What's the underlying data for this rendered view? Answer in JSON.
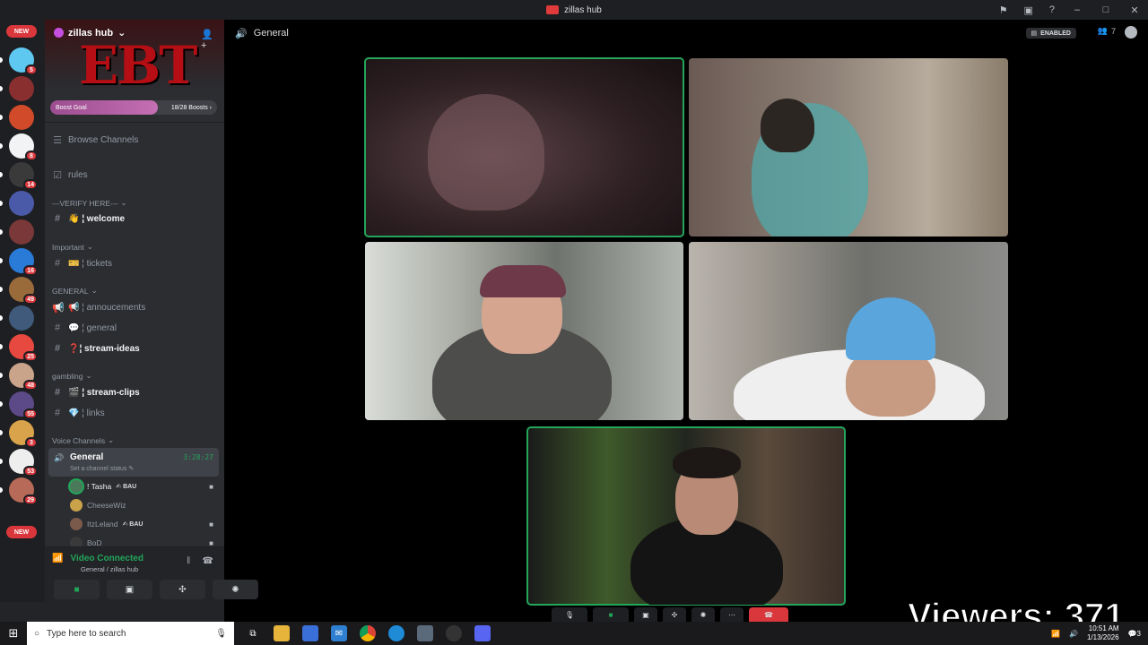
{
  "window": {
    "title": "zillas hub"
  },
  "rail": {
    "new_top": "NEW",
    "new_bottom": "NEW",
    "servers": [
      {
        "badge": "5"
      },
      {
        "badge": ""
      },
      {
        "badge": ""
      },
      {
        "badge": "8"
      },
      {
        "badge": "14"
      },
      {
        "badge": ""
      },
      {
        "badge": ""
      },
      {
        "badge": "16"
      },
      {
        "badge": "49"
      },
      {
        "badge": ""
      },
      {
        "badge": "25"
      },
      {
        "badge": "48"
      },
      {
        "badge": "55"
      },
      {
        "badge": "3"
      },
      {
        "badge": "53"
      },
      {
        "badge": "29"
      }
    ]
  },
  "sidebar": {
    "server_name": "zillas hub",
    "banner_text": "EBT",
    "boost_goal": {
      "label": "Boost Goal",
      "count": "18/28 Boosts",
      "progress": 0.643
    },
    "browse_channels": "Browse Channels",
    "rules": "rules",
    "categories": {
      "verify": "---VERIFY HERE---",
      "important": "Important",
      "general": "GENERAL",
      "gambling": "gambling",
      "voice": "Voice Channels"
    },
    "channels": {
      "welcome": "👋 ¦ welcome",
      "tickets": "🎫 ¦ tickets",
      "annoucements": "📢 ¦ annoucements",
      "general": "💬 ¦ general",
      "stream_ideas": "❓¦ stream-ideas",
      "stream_clips": "🎬 ¦ stream-clips",
      "links": "💎 ¦ links"
    },
    "voice_channel": {
      "name": "General",
      "status": "Set a channel status",
      "time": "3:28:27",
      "users": [
        {
          "name": "! Tasha",
          "tag": "BAU",
          "speaking": true,
          "camera": true
        },
        {
          "name": "CheeseWiz",
          "tag": "",
          "speaking": false,
          "camera": false
        },
        {
          "name": "ItzLeland",
          "tag": "BAU",
          "speaking": false,
          "camera": true
        },
        {
          "name": "BoD",
          "tag": "",
          "speaking": false,
          "camera": true
        }
      ]
    },
    "voice_panel": {
      "status": "Video Connected",
      "location": "General / zillas hub"
    }
  },
  "stage": {
    "channel": "General",
    "enabled_label": "ENABLED",
    "member_count": "7"
  },
  "overlay": {
    "viewers": "Viewers: 371"
  },
  "taskbar": {
    "search_placeholder": "Type here to search",
    "time": "10:51 AM",
    "date": "1/13/2026",
    "notifications": "3"
  },
  "colors": {
    "speaking": "#23a55a",
    "danger": "#da373c",
    "sidebar": "#2b2d31",
    "rail": "#1e1f22"
  }
}
